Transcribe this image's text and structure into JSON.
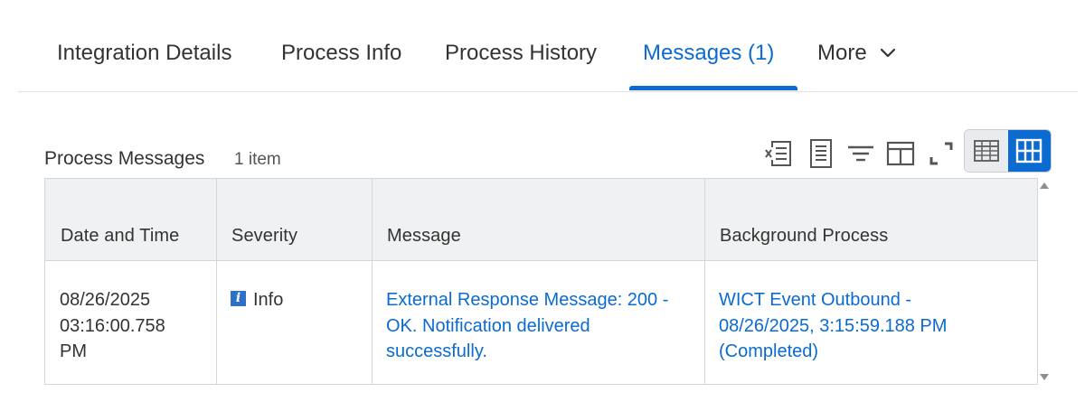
{
  "tabs": [
    {
      "label": "Integration Details",
      "active": false
    },
    {
      "label": "Process Info",
      "active": false
    },
    {
      "label": "Process History",
      "active": false
    },
    {
      "label": "Messages (1)",
      "active": true
    },
    {
      "label": "More",
      "active": false
    }
  ],
  "section": {
    "title": "Process Messages",
    "count": "1 item"
  },
  "toolbar": {
    "icons": [
      "export-excel-icon",
      "export-pdf-icon",
      "filter-icon",
      "column-layout-icon",
      "fullscreen-icon"
    ],
    "view_modes": [
      "table-view-icon",
      "grid-view-icon"
    ],
    "active_view": "grid"
  },
  "table": {
    "columns": [
      "Date and Time",
      "Severity",
      "Message",
      "Background Process"
    ],
    "rows": [
      {
        "date_line1": "08/26/2025",
        "date_line2": "03:16:00.758",
        "date_line3": "PM",
        "severity": "Info",
        "message_line1": "External Response Message: 200 -",
        "message_line2": "OK. Notification delivered",
        "message_line3": "successfully.",
        "process_line1": "WICT Event Outbound -",
        "process_line2": "08/26/2025, 3:15:59.188 PM",
        "process_line3": "(Completed)"
      }
    ]
  },
  "colors": {
    "accent": "#0b6bd0",
    "text": "#333333",
    "header_bg": "#f0f1f2",
    "border": "#d3d6da",
    "info_icon": "#2d72c8"
  }
}
